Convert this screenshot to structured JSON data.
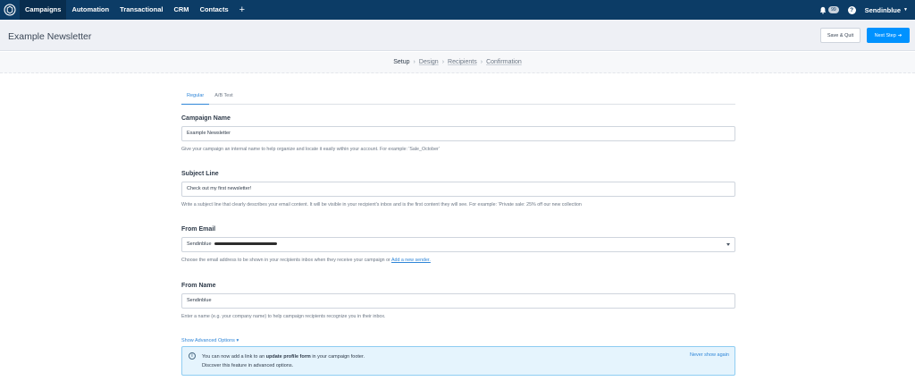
{
  "nav": {
    "items": [
      "Campaigns",
      "Automation",
      "Transactional",
      "CRM",
      "Contacts"
    ],
    "plus": "+",
    "notifications_count": "99",
    "account": "Sendinblue"
  },
  "header": {
    "title": "Example Newsletter",
    "save_quit": "Save & Quit",
    "next_step": "Next Step"
  },
  "stepper": {
    "steps": [
      "Setup",
      "Design",
      "Recipients",
      "Confirmation"
    ]
  },
  "tabs": [
    "Regular",
    "A/B Test"
  ],
  "campaign_name": {
    "label": "Campaign Name",
    "value": "Example Newsletter",
    "help": "Give your campaign an internal name to help organize and locate it easily within your account. For example: 'Sale_October'"
  },
  "subject_line": {
    "label": "Subject Line",
    "value": "Check out my first newsletter!",
    "help": "Write a subject line that clearly describes your email content. It will be visible in your recipient's inbox and is the first content they will see. For example: 'Private sale: 25% off our new collection"
  },
  "from_email": {
    "label": "From Email",
    "value": "Sendinblue",
    "help_text": "Choose the email address to be shown in your recipients inbox when they receive your campaign or",
    "help_link": "Add a new sender."
  },
  "from_name": {
    "label": "From Name",
    "value": "Sendinblue",
    "help": "Enter a name (e.g. your company name) to help campaign recipients recognize you in their inbox."
  },
  "advanced": {
    "toggle": "Show Advanced Options ▾"
  },
  "notice": {
    "line1_pre": "You can now add a link to an",
    "line1_bold": "update profile form",
    "line1_post": "in your campaign footer.",
    "line2": "Discover this feature in advanced options.",
    "dismiss": "Never show again"
  }
}
